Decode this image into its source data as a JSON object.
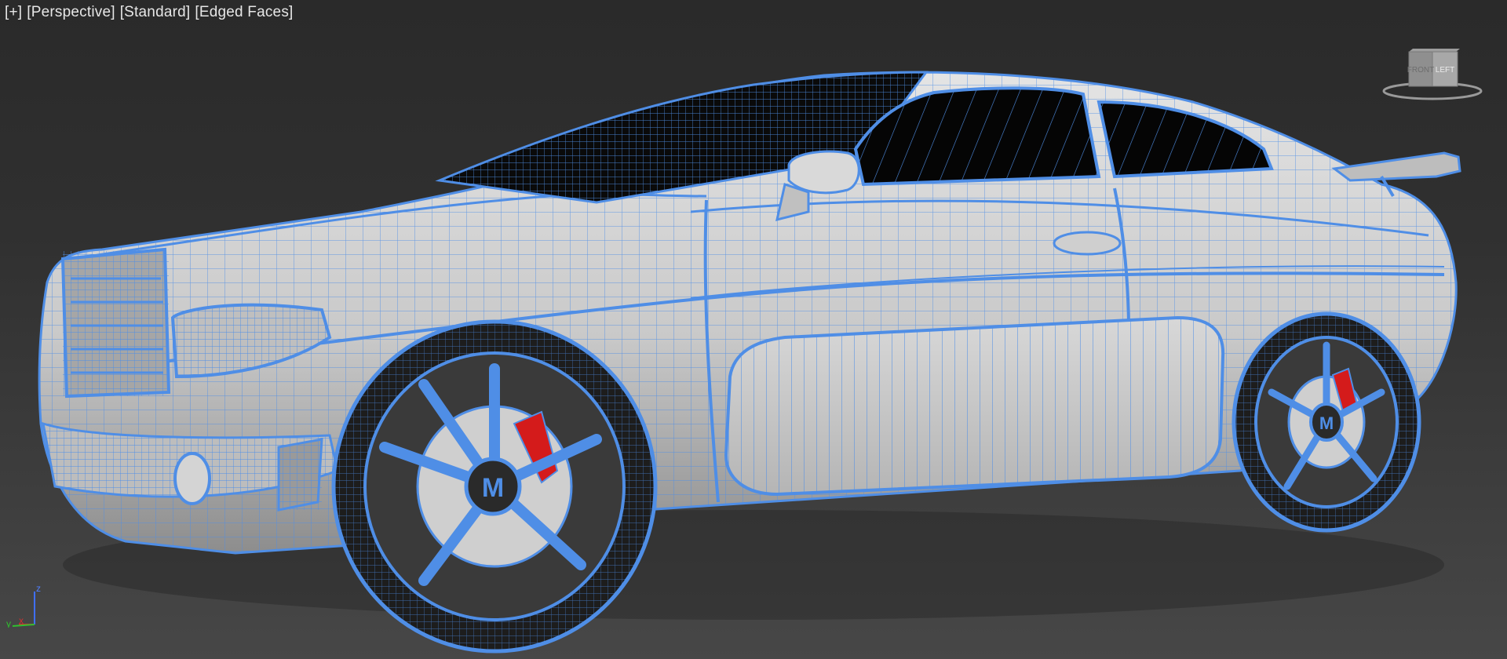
{
  "viewport": {
    "labels": [
      "[+]",
      "[Perspective]",
      "[Standard]",
      "[Edged Faces]"
    ],
    "background_top": "#2a2a2a",
    "background_bottom": "#474747"
  },
  "viewcube": {
    "faces": {
      "front": "FRONT",
      "left": "LEFT"
    }
  },
  "axis_tripod": {
    "x": "x",
    "y": "y",
    "z": "z"
  },
  "model": {
    "wire_color": "#4f8ee6",
    "shaded_color": "#c7c7c7",
    "glass_color": "#050505",
    "caliper_color": "#d41b1b",
    "wheel_badge": "M"
  }
}
